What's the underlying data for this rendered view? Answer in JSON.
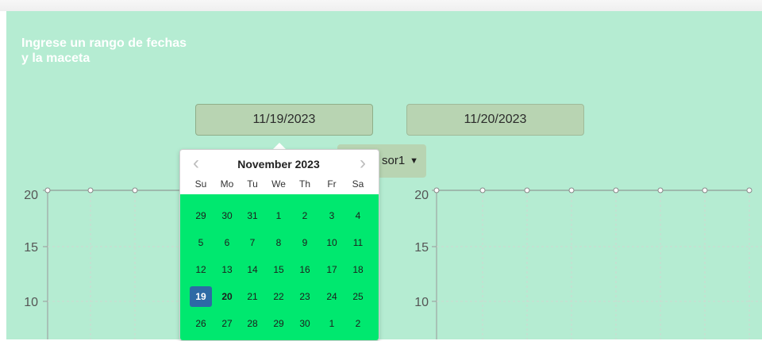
{
  "heading": "Ingrese un rango de fechas y la maceta",
  "date_start": "11/19/2023",
  "date_end": "11/20/2023",
  "sensor_select": {
    "selected": "Sensor1",
    "visible_fragment": "sor1"
  },
  "datepicker": {
    "title": "November 2023",
    "prev_symbol": "‹",
    "next_symbol": "›",
    "weekdays": [
      "Su",
      "Mo",
      "Tu",
      "We",
      "Th",
      "Fr",
      "Sa"
    ],
    "weeks": [
      [
        "29",
        "30",
        "31",
        "1",
        "2",
        "3",
        "4"
      ],
      [
        "5",
        "6",
        "7",
        "8",
        "9",
        "10",
        "11"
      ],
      [
        "12",
        "13",
        "14",
        "15",
        "16",
        "17",
        "18"
      ],
      [
        "19",
        "20",
        "21",
        "22",
        "23",
        "24",
        "25"
      ],
      [
        "26",
        "27",
        "28",
        "29",
        "30",
        "1",
        "2"
      ]
    ],
    "selected_day": "19",
    "bold_day": "20",
    "colors": {
      "grid": "#00e86f",
      "selected": "#2d6aa5"
    }
  },
  "charts": {
    "left": {
      "ticks": [
        "20",
        "15",
        "10"
      ]
    },
    "right": {
      "ticks": [
        "20",
        "15",
        "10"
      ]
    }
  },
  "colors": {
    "panel": "#b5ecd2",
    "input": "#b8d4b2",
    "heading": "#ffffff"
  }
}
